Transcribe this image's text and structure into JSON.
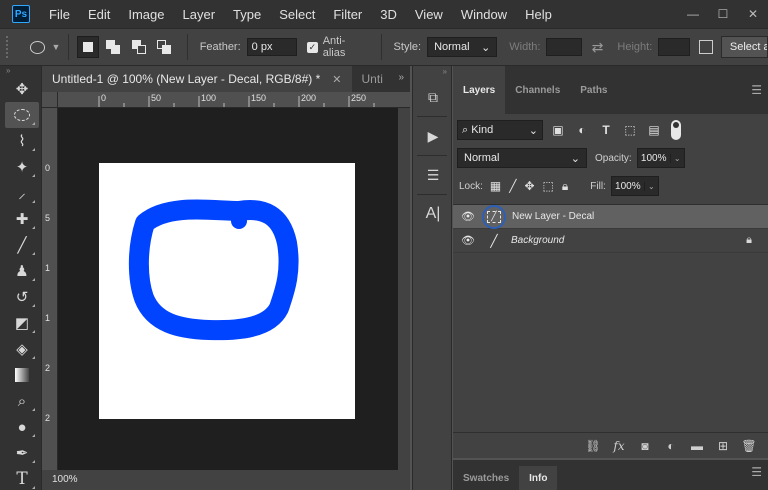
{
  "app": {
    "logo_text": "Ps"
  },
  "menu": [
    "File",
    "Edit",
    "Image",
    "Layer",
    "Type",
    "Select",
    "Filter",
    "3D",
    "View",
    "Window",
    "Help"
  ],
  "window_controls": [
    "—",
    "☐",
    "✕"
  ],
  "options": {
    "feather_label": "Feather:",
    "feather_value": "0 px",
    "antialias_label": "Anti-alias",
    "style_label": "Style:",
    "style_value": "Normal",
    "width_label": "Width:",
    "height_label": "Height:",
    "select_mask_label": "Select an"
  },
  "document": {
    "active_tab": "Untitled-1 @ 100% (New Layer - Decal, RGB/8#) *",
    "close_glyph": "✕",
    "second_tab": "Unti",
    "zoom_status": "100%",
    "ruler_h_labels": [
      "0",
      "50",
      "100",
      "150",
      "200",
      "250"
    ],
    "ruler_v_labels": [
      "0",
      "5",
      "1",
      "1",
      "2",
      "2"
    ],
    "stroke_color": "#0044ff",
    "canvas_color": "#ffffff"
  },
  "layers_panel": {
    "tabs": [
      "Layers",
      "Channels",
      "Paths"
    ],
    "kind_label": "Kind",
    "blend_mode": "Normal",
    "opacity_label": "Opacity:",
    "opacity_value": "100%",
    "lock_label": "Lock:",
    "fill_label": "Fill:",
    "fill_value": "100%",
    "layers": [
      {
        "name": "New Layer - Decal",
        "selected": true
      },
      {
        "name": "Background",
        "selected": false,
        "locked": true
      }
    ]
  },
  "bottom_panel": {
    "tabs": [
      "Swatches",
      "Info"
    ]
  },
  "colors": {
    "accent": "#31a8ff",
    "selection_ring": "#2b5fb8"
  }
}
